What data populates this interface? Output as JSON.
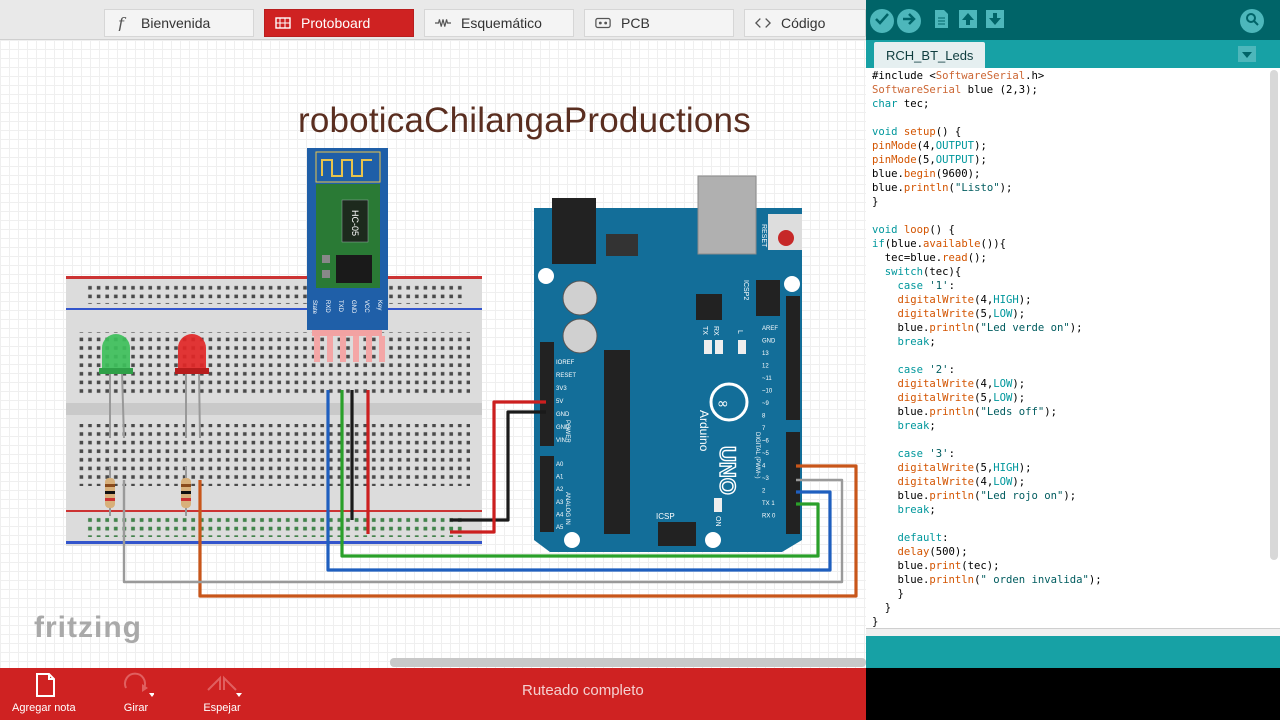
{
  "fritzing": {
    "tabs": [
      {
        "label": "Bienvenida",
        "icon": "fritzing-f-icon",
        "active": false
      },
      {
        "label": "Protoboard",
        "icon": "breadboard-icon",
        "active": true
      },
      {
        "label": "Esquemático",
        "icon": "schematic-icon",
        "active": false
      },
      {
        "label": "PCB",
        "icon": "pcb-icon",
        "active": false
      },
      {
        "label": "Código",
        "icon": "code-icon",
        "active": false
      }
    ],
    "sketch_title": "roboticaChilangaProductions",
    "logo": "fritzing",
    "components": {
      "bt_module": {
        "label": "HC-05",
        "pins": [
          "State",
          "RXD",
          "TXD",
          "GND",
          "VCC",
          "Key"
        ]
      },
      "arduino": {
        "brand": "Arduino",
        "model": "UNO",
        "reset": "RESET",
        "icsp": "ICSP",
        "icsp2": "ICSP2",
        "power_pins": [
          "IOREF",
          "RESET",
          "3V3",
          "5V",
          "GND",
          "GND",
          "VIN"
        ],
        "analog_pins": [
          "A0",
          "A1",
          "A2",
          "A3",
          "A4",
          "A5"
        ],
        "digital_pins": [
          "AREF",
          "GND",
          "13",
          "12",
          "~11",
          "~10",
          "~9",
          "8",
          "7",
          "~6",
          "~5",
          "4",
          "~3",
          "2",
          "TX 1",
          "RX 0"
        ],
        "power_label": "POWER",
        "analog_label": "ANALOG IN",
        "digital_label": "DIGITAL (PWM~)",
        "tx": "TX",
        "rx": "RX",
        "l": "L",
        "on": "ON"
      },
      "leds": [
        {
          "color": "#3dbf5a"
        },
        {
          "color": "#e12626"
        }
      ]
    },
    "bottom_bar": {
      "buttons": [
        {
          "label": "Agregar nota",
          "icon": "note-icon"
        },
        {
          "label": "Girar",
          "icon": "rotate-icon"
        },
        {
          "label": "Espejar",
          "icon": "mirror-icon"
        }
      ],
      "status": "Ruteado completo"
    },
    "colors": {
      "accent": "#cf2222",
      "wire_red": "#cc1f1f",
      "wire_black": "#1a1a1a",
      "wire_green": "#2aa02a",
      "wire_blue": "#1f5fbf",
      "wire_orange": "#c8561a",
      "wire_gray": "#9a9a9a"
    }
  },
  "ide": {
    "toolbar": [
      "verify-icon",
      "upload-icon",
      "new-icon",
      "open-icon",
      "save-icon",
      "serial-monitor-icon"
    ],
    "tab": "RCH_BT_Leds",
    "code_lines": [
      "#include <SoftwareSerial.h>",
      "SoftwareSerial blue (2,3);",
      "char tec;",
      "",
      "void setup() {",
      "pinMode(4,OUTPUT);",
      "pinMode(5,OUTPUT);",
      "blue.begin(9600);",
      "blue.println(\"Listo\");",
      "}",
      "",
      "void loop() {",
      "if(blue.available()){",
      "  tec=blue.read();",
      "  switch(tec){",
      "    case '1':",
      "    digitalWrite(4,HIGH);",
      "    digitalWrite(5,LOW);",
      "    blue.println(\"Led verde on\");",
      "    break;",
      "",
      "    case '2':",
      "    digitalWrite(4,LOW);",
      "    digitalWrite(5,LOW);",
      "    blue.println(\"Leds off\");",
      "    break;",
      "",
      "    case '3':",
      "    digitalWrite(5,HIGH);",
      "    digitalWrite(4,LOW);",
      "    blue.println(\"Led rojo on\");",
      "    break;",
      "",
      "    default:",
      "    delay(500);",
      "    blue.print(tec);",
      "    blue.println(\" orden invalida\");",
      "    }",
      "  }",
      "}"
    ],
    "colors": {
      "toolbar": "#006468",
      "tabbar": "#17a1a5",
      "keyword": "#00979c",
      "function": "#d35400"
    }
  }
}
